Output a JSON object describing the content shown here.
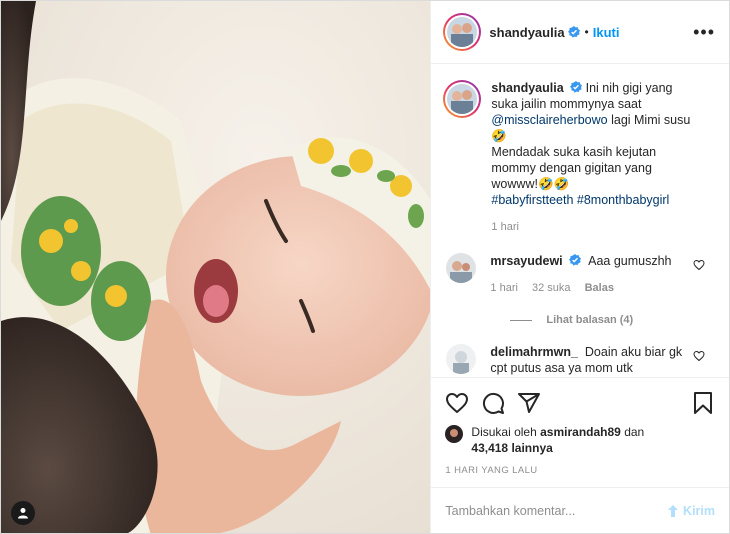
{
  "header": {
    "username": "shandyaulia",
    "dot": "•",
    "follow_label": "Ikuti",
    "more_label": "•••"
  },
  "caption": {
    "username": "shandyaulia",
    "text_1": "Ini nih gigi yang suka jailin mommynya saat",
    "mention": "@missclaireherbowo",
    "text_2": "lagi Mimi susu🤣",
    "text_3": "Mendadak suka kasih kejutan mommy dengan gigitan yang wowww!🤣🤣",
    "hashtag_1": "#babyfirstteeth",
    "hashtag_2": "#8monthbabygirl",
    "time": "1 hari"
  },
  "comments": [
    {
      "username": "mrsayudewi",
      "text": "Aaa gumuszhh",
      "time": "1 hari",
      "likes": "32 suka",
      "reply": "Balas",
      "view_replies": "Lihat balasan (4)"
    },
    {
      "username": "delimahrmwn_",
      "text": "Doain aku biar gk cpt putus asa ya mom utk menjemput buah hati 🙏 semoga"
    }
  ],
  "likes": {
    "prefix": "Disukai oleh",
    "user": "asmirandah89",
    "joiner": "dan",
    "count": "43,418 lainnya"
  },
  "post_date": "1 HARI YANG LALU",
  "add_comment": {
    "placeholder": "Tambahkan komentar...",
    "post_label": "Kirim"
  },
  "colors": {
    "accent": "#0095f6",
    "link": "#00376b",
    "muted": "#8e8e8e",
    "post_disabled": "#b2dffc"
  },
  "icons": [
    "verified-badge-icon",
    "heart-icon",
    "comment-icon",
    "share-icon",
    "bookmark-icon",
    "user-tag-icon",
    "emoji-icon"
  ]
}
